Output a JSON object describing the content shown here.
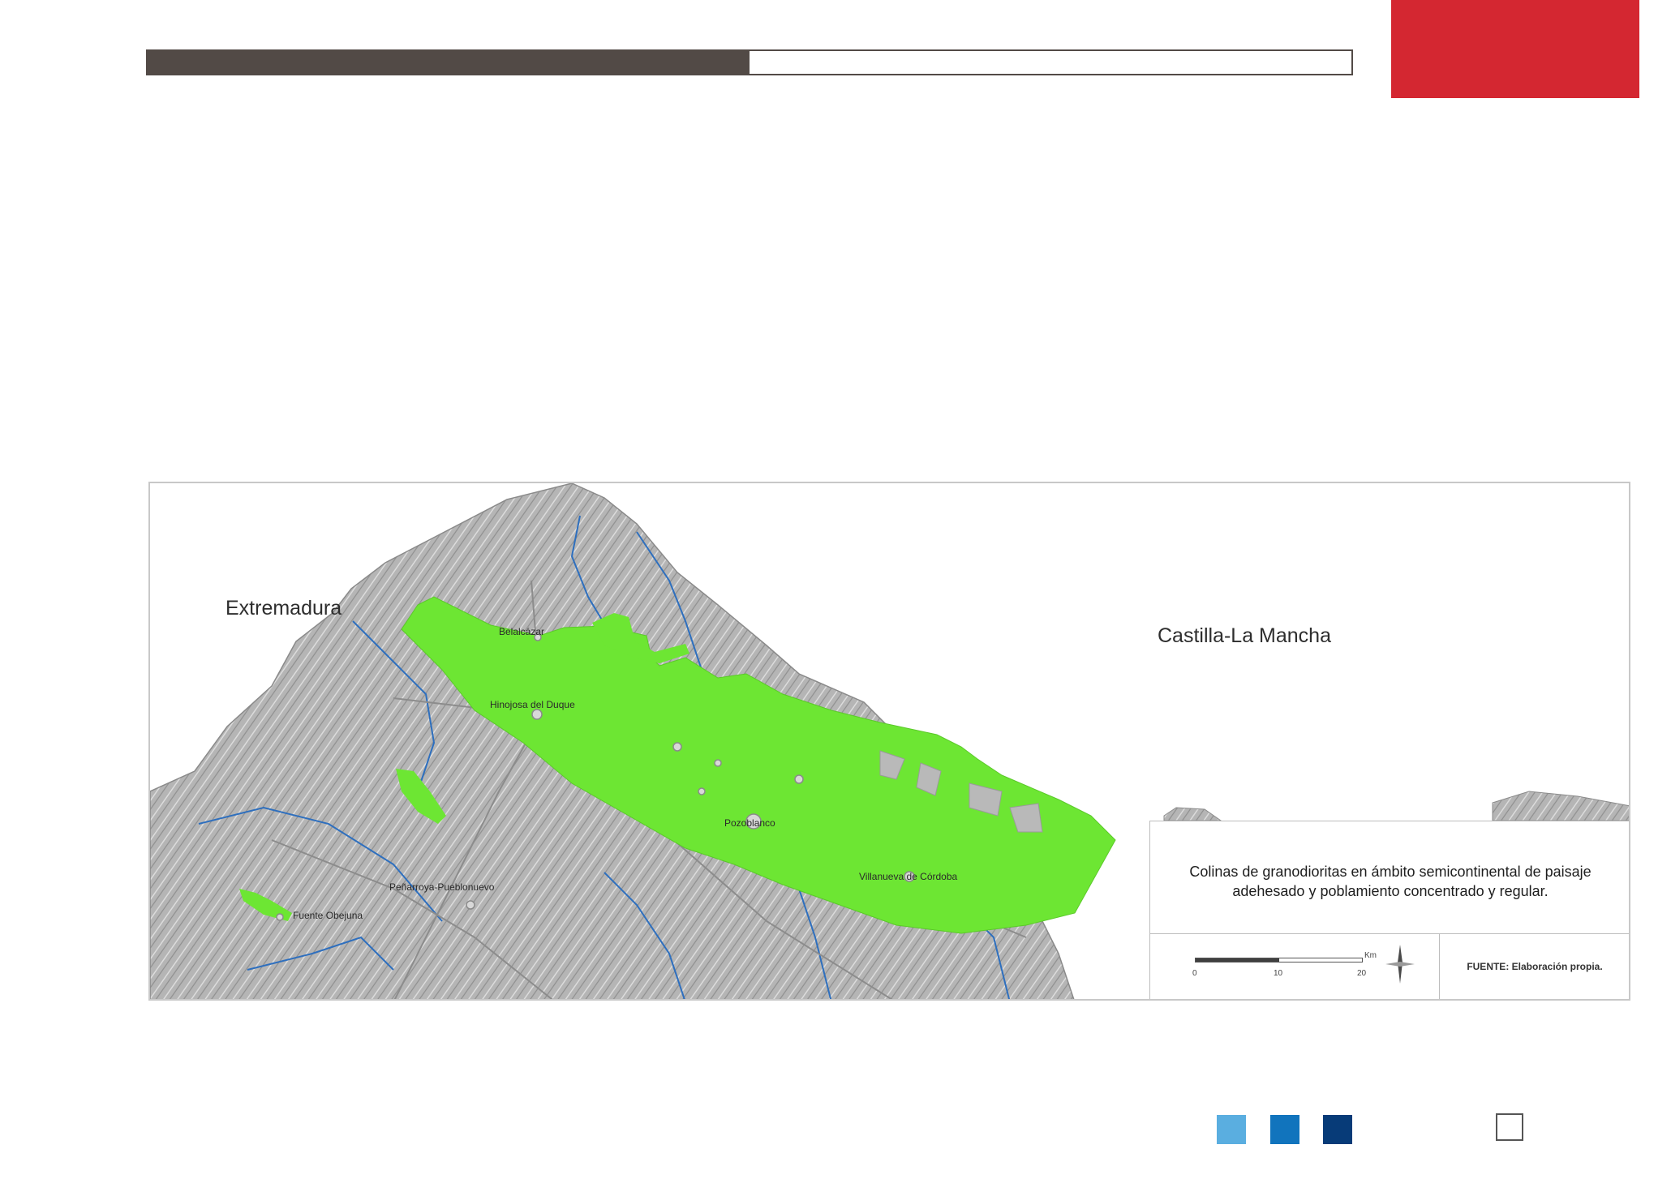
{
  "header": {
    "progress": {
      "fraction": 0.5,
      "fill_color": "#524a46"
    },
    "accent_color": "#d42731"
  },
  "map": {
    "regions": [
      "Extremadura",
      "Castilla-La Mancha"
    ],
    "towns": [
      "Belalcázar",
      "Hinojosa del Duque",
      "Pozoblanco",
      "Villanueva de Córdoba",
      "Peñarroya-Pueblonuevo",
      "Fuente Obejuna"
    ],
    "colors": {
      "unit_highlight": "#6de633",
      "relief": "#b9b9b9",
      "rivers": "#2e6fbe",
      "outside": "#ffffff"
    },
    "legend": {
      "title_line1": "Colinas de granodioritas en ámbito semicontinental de paisaje",
      "title_line2": "adehesado y poblamiento concentrado y regular.",
      "scale_unit": "Km",
      "scale_ticks": [
        "0",
        "10",
        "20"
      ],
      "source": "FUENTE: Elaboración propia."
    }
  },
  "footer": {
    "swatches": [
      "#5aaee0",
      "#1174bd",
      "#073b78"
    ]
  }
}
